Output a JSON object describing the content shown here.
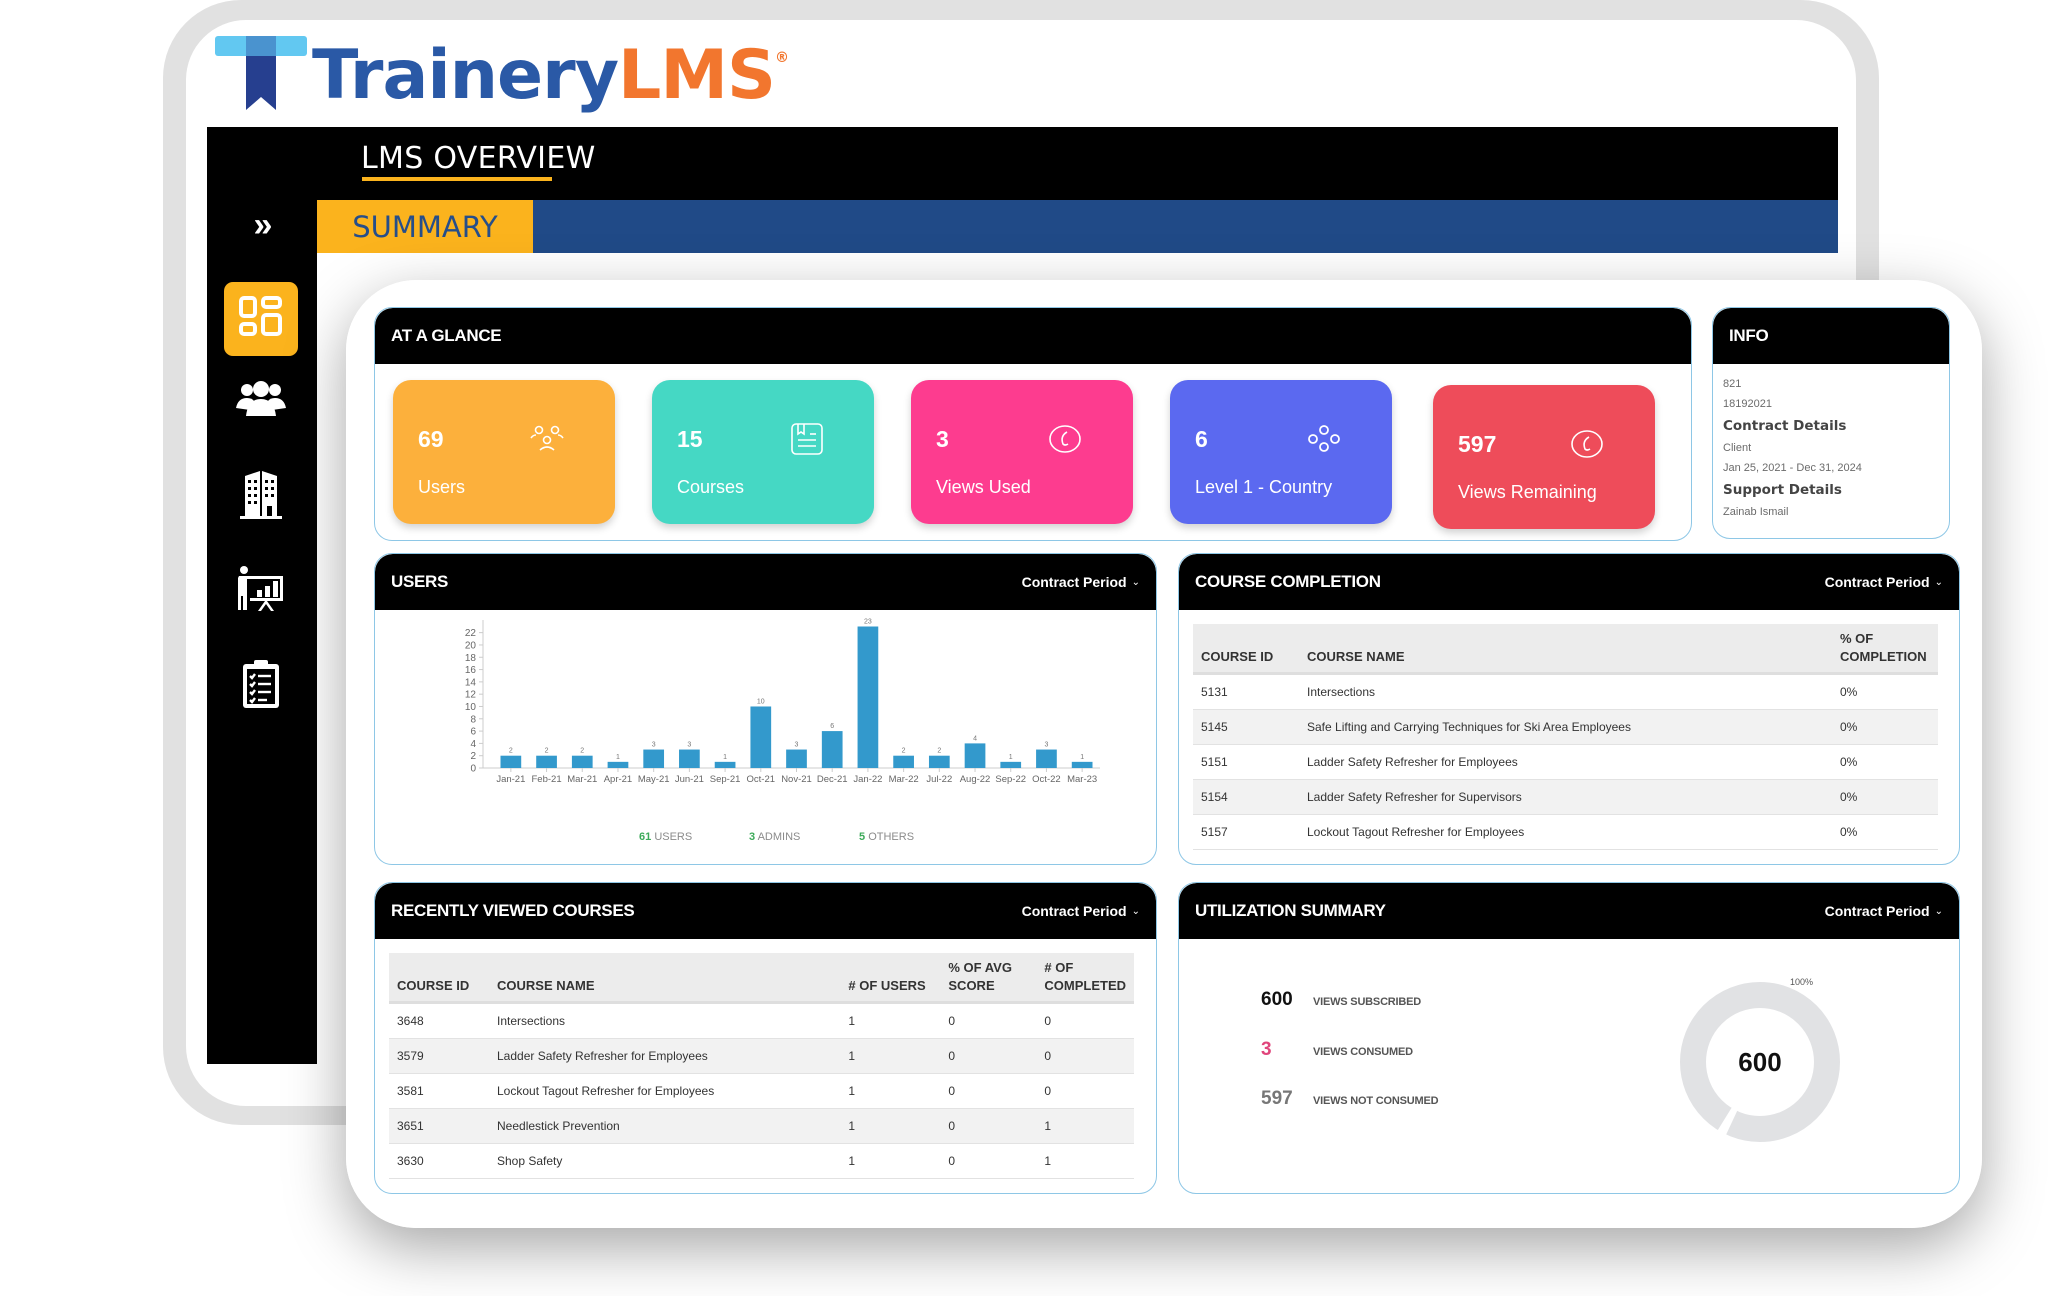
{
  "brand": {
    "name_part1": "Trainery",
    "name_part2": "LMS",
    "registered": "®",
    "colors": {
      "blue": "#2a59a6",
      "orange": "#f2762e",
      "yellow": "#fbb31d",
      "navy": "#204a87"
    }
  },
  "header": {
    "title": "LMS OVERVIEW",
    "active_tab": "SUMMARY",
    "expand_glyph": "»"
  },
  "sidebar": {
    "items": [
      {
        "name": "dashboard-icon",
        "active": true
      },
      {
        "name": "users-icon",
        "active": false
      },
      {
        "name": "building-icon",
        "active": false
      },
      {
        "name": "presentation-icon",
        "active": false
      },
      {
        "name": "clipboard-checklist-icon",
        "active": false
      }
    ]
  },
  "glance": {
    "title": "AT A GLANCE",
    "tiles": [
      {
        "value": "69",
        "label": "Users",
        "icon": "users-outline-icon",
        "color": "#fcb03c"
      },
      {
        "value": "15",
        "label": "Courses",
        "icon": "course-book-icon",
        "color": "#45d8c4"
      },
      {
        "value": "3",
        "label": "Views Used",
        "icon": "eye-circle-icon",
        "color": "#fd3c8f"
      },
      {
        "value": "6",
        "label": "Level 1 - Country",
        "icon": "network-nodes-icon",
        "color": "#5b69f0"
      },
      {
        "value": "597",
        "label": "Views Remaining",
        "icon": "eye-circle-icon",
        "color": "#ee4c5a"
      }
    ]
  },
  "info": {
    "title": "INFO",
    "line1": "821",
    "line2": "18192021",
    "contract_heading": "Contract Details",
    "contract_client": "Client",
    "contract_dates": "Jan 25, 2021 - Dec 31, 2024",
    "support_heading": "Support Details",
    "support_name": "Zainab Ismail"
  },
  "period_label": "Contract Period",
  "users_panel": {
    "title": "USERS",
    "legend": [
      {
        "count": "61",
        "label": "USERS"
      },
      {
        "count": "3",
        "label": "ADMINS"
      },
      {
        "count": "5",
        "label": "OTHERS"
      }
    ]
  },
  "chart_data": {
    "type": "bar",
    "title": "USERS",
    "xlabel": "",
    "ylabel": "",
    "categories": [
      "Jan-21",
      "Feb-21",
      "Mar-21",
      "Apr-21",
      "May-21",
      "Jun-21",
      "Sep-21",
      "Oct-21",
      "Nov-21",
      "Dec-21",
      "Jan-22",
      "Mar-22",
      "Jul-22",
      "Aug-22",
      "Sep-22",
      "Oct-22",
      "Mar-23"
    ],
    "values": [
      2,
      2,
      2,
      1,
      3,
      3,
      1,
      10,
      3,
      6,
      23,
      2,
      2,
      4,
      1,
      3,
      1
    ],
    "yticks": [
      0,
      2,
      4,
      6,
      8,
      10,
      12,
      14,
      16,
      18,
      20,
      22
    ],
    "ylim": [
      0,
      23
    ],
    "bar_color": "#3399cc",
    "grid": false,
    "data_labels": true
  },
  "course_completion": {
    "title": "COURSE COMPLETION",
    "columns": [
      "COURSE ID",
      "COURSE NAME",
      "% OF COMPLETION"
    ],
    "rows": [
      [
        "5131",
        "Intersections",
        "0%"
      ],
      [
        "5145",
        "Safe Lifting and Carrying Techniques for Ski Area Employees",
        "0%"
      ],
      [
        "5151",
        "Ladder Safety Refresher for Employees",
        "0%"
      ],
      [
        "5154",
        "Ladder Safety Refresher for Supervisors",
        "0%"
      ],
      [
        "5157",
        "Lockout Tagout Refresher for Employees",
        "0%"
      ]
    ]
  },
  "recent_courses": {
    "title": "RECENTLY VIEWED COURSES",
    "columns": [
      "COURSE ID",
      "COURSE NAME",
      "# OF USERS",
      "% OF AVG SCORE",
      "# OF COMPLETED"
    ],
    "rows": [
      [
        "3648",
        "Intersections",
        "1",
        "0",
        "0"
      ],
      [
        "3579",
        "Ladder Safety Refresher for Employees",
        "1",
        "0",
        "0"
      ],
      [
        "3581",
        "Lockout Tagout Refresher for Employees",
        "1",
        "0",
        "0"
      ],
      [
        "3651",
        "Needlestick Prevention",
        "1",
        "0",
        "1"
      ],
      [
        "3630",
        "Shop Safety",
        "1",
        "0",
        "1"
      ]
    ]
  },
  "utilization": {
    "title": "UTILIZATION SUMMARY",
    "rows": [
      {
        "value": "600",
        "label": "VIEWS SUBSCRIBED",
        "color": "#111111"
      },
      {
        "value": "3",
        "label": "VIEWS CONSUMED",
        "color": "#e0457b"
      },
      {
        "value": "597",
        "label": "VIEWS NOT CONSUMED",
        "color": "#777777"
      }
    ],
    "donut_center": "600",
    "donut_label": "100%",
    "donut_fraction_consumed": 0.005
  }
}
